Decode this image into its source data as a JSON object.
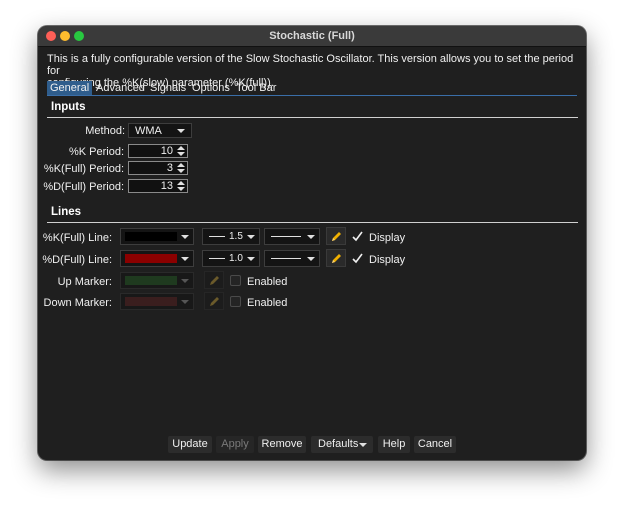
{
  "window": {
    "title": "Stochastic (Full)"
  },
  "description": {
    "line1": "This is a fully configurable version of the Slow Stochastic Oscillator. This version allows you to set the period for",
    "line2": "configuring the %K(slow) parameter (%K(full))."
  },
  "tabs": [
    {
      "label": "General",
      "active": true
    },
    {
      "label": "Advanced"
    },
    {
      "label": "Signals"
    },
    {
      "label": "Options"
    },
    {
      "label": "Tool Bar"
    }
  ],
  "inputs": {
    "heading": "Inputs",
    "method": {
      "label": "Method:",
      "value": "WMA"
    },
    "k_period": {
      "label": "%K Period:",
      "value": "10"
    },
    "k_full_period": {
      "label": "%K(Full) Period:",
      "value": "3"
    },
    "d_full_period": {
      "label": "%D(Full) Period:",
      "value": "13"
    }
  },
  "lines": {
    "heading": "Lines",
    "items": [
      {
        "label": "%K(Full) Line:",
        "color": "#000000",
        "width": "1.5",
        "check_label": "Display",
        "checked": true,
        "enabled": true
      },
      {
        "label": "%D(Full) Line:",
        "color": "#8b0000",
        "width": "1.0",
        "check_label": "Display",
        "checked": true,
        "enabled": true
      },
      {
        "label": "Up Marker:",
        "color": "#1f3a1f",
        "check_label": "Enabled",
        "checked": false,
        "enabled": false
      },
      {
        "label": "Down Marker:",
        "color": "#3a1e1e",
        "check_label": "Enabled",
        "checked": false,
        "enabled": false
      }
    ]
  },
  "buttons": {
    "update": "Update",
    "apply": "Apply",
    "remove": "Remove",
    "defaults": "Defaults",
    "help": "Help",
    "cancel": "Cancel"
  },
  "colors": {
    "tab_active": "#2f5d8c",
    "pencil": "#f0b000",
    "window_bg": "#1f1f1f"
  }
}
